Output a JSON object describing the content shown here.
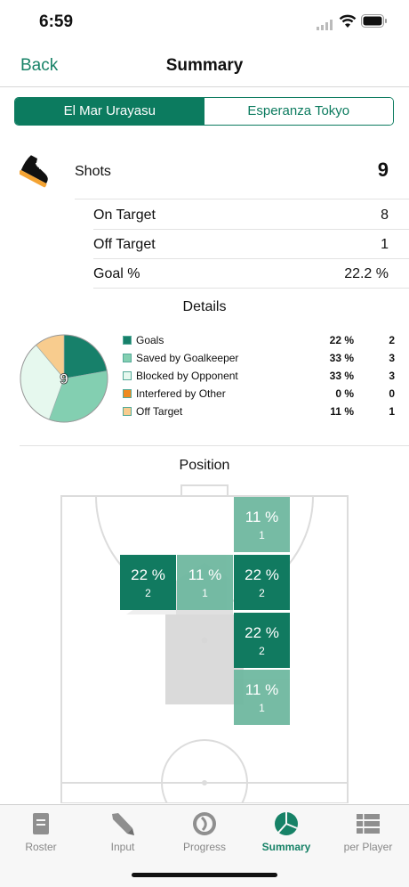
{
  "status": {
    "time": "6:59"
  },
  "nav": {
    "back": "Back",
    "title": "Summary"
  },
  "segment": {
    "team_a": "El Mar Urayasu",
    "team_b": "Esperanza Tokyo",
    "selected": "team_a"
  },
  "shots": {
    "icon": "shoe-icon",
    "label": "Shots",
    "value": "9",
    "rows": [
      {
        "label": "On Target",
        "value": "8"
      },
      {
        "label": "Off Target",
        "value": "1"
      },
      {
        "label": "Goal %",
        "value": "22.2 %"
      }
    ]
  },
  "details": {
    "title": "Details",
    "center_label": "9",
    "items": [
      {
        "name": "Goals",
        "pct": "22 %",
        "count": "2",
        "color": "#17806a"
      },
      {
        "name": "Saved by Goalkeeper",
        "pct": "33 %",
        "count": "3",
        "color": "#83cfb1"
      },
      {
        "name": "Blocked by Opponent",
        "pct": "33 %",
        "count": "3",
        "color": "#e6f8ee"
      },
      {
        "name": "Interfered by Other",
        "pct": "0 %",
        "count": "0",
        "color": "#ef8a1f"
      },
      {
        "name": "Off Target",
        "pct": "11 %",
        "count": "1",
        "color": "#f8cc8e"
      }
    ],
    "slices": [
      2,
      3,
      3,
      0,
      1
    ]
  },
  "position": {
    "title": "Position",
    "zones": [
      {
        "pct": "11 %",
        "count": "1",
        "shade": "light"
      },
      {
        "pct": "22 %",
        "count": "2",
        "shade": "dark"
      },
      {
        "pct": "11 %",
        "count": "1",
        "shade": "light"
      },
      {
        "pct": "22 %",
        "count": "2",
        "shade": "dark"
      },
      {
        "pct": "22 %",
        "count": "2",
        "shade": "dark"
      },
      {
        "pct": "11 %",
        "count": "1",
        "shade": "light"
      }
    ]
  },
  "tabs": [
    {
      "label": "Roster",
      "icon": "roster-icon"
    },
    {
      "label": "Input",
      "icon": "pen-icon"
    },
    {
      "label": "Progress",
      "icon": "progress-icon"
    },
    {
      "label": "Summary",
      "icon": "pie-chart-icon",
      "active": true
    },
    {
      "label": "per Player",
      "icon": "list-icon"
    }
  ],
  "colors": {
    "accent": "#178267",
    "zone_dark": "#117a60",
    "zone_light": "#6fb8a0"
  }
}
